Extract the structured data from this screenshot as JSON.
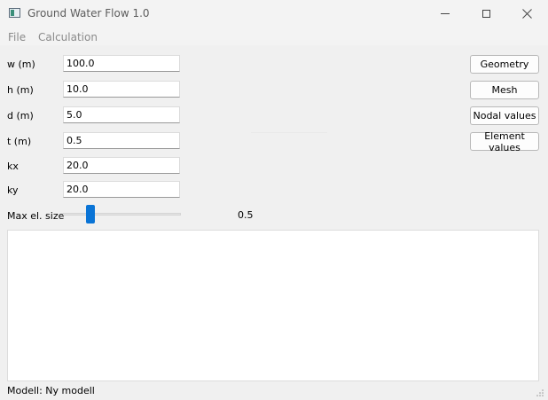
{
  "window": {
    "title": "Ground Water Flow 1.0"
  },
  "menu": {
    "items": [
      {
        "label": "File"
      },
      {
        "label": "Calculation"
      }
    ]
  },
  "form": {
    "fields": [
      {
        "label": "w (m)",
        "value": "100.0"
      },
      {
        "label": "h (m)",
        "value": "10.0"
      },
      {
        "label": "d (m)",
        "value": "5.0"
      },
      {
        "label": "t (m)",
        "value": "0.5"
      },
      {
        "label": "kx",
        "value": "20.0"
      },
      {
        "label": "ky",
        "value": "20.0"
      }
    ]
  },
  "slider": {
    "label": "Max el. size",
    "value": "0.5"
  },
  "buttons": {
    "geometry": "Geometry",
    "mesh": "Mesh",
    "nodal_values": "Nodal values",
    "element_values": "Element values"
  },
  "status": {
    "text": "Modell: Ny modell"
  }
}
